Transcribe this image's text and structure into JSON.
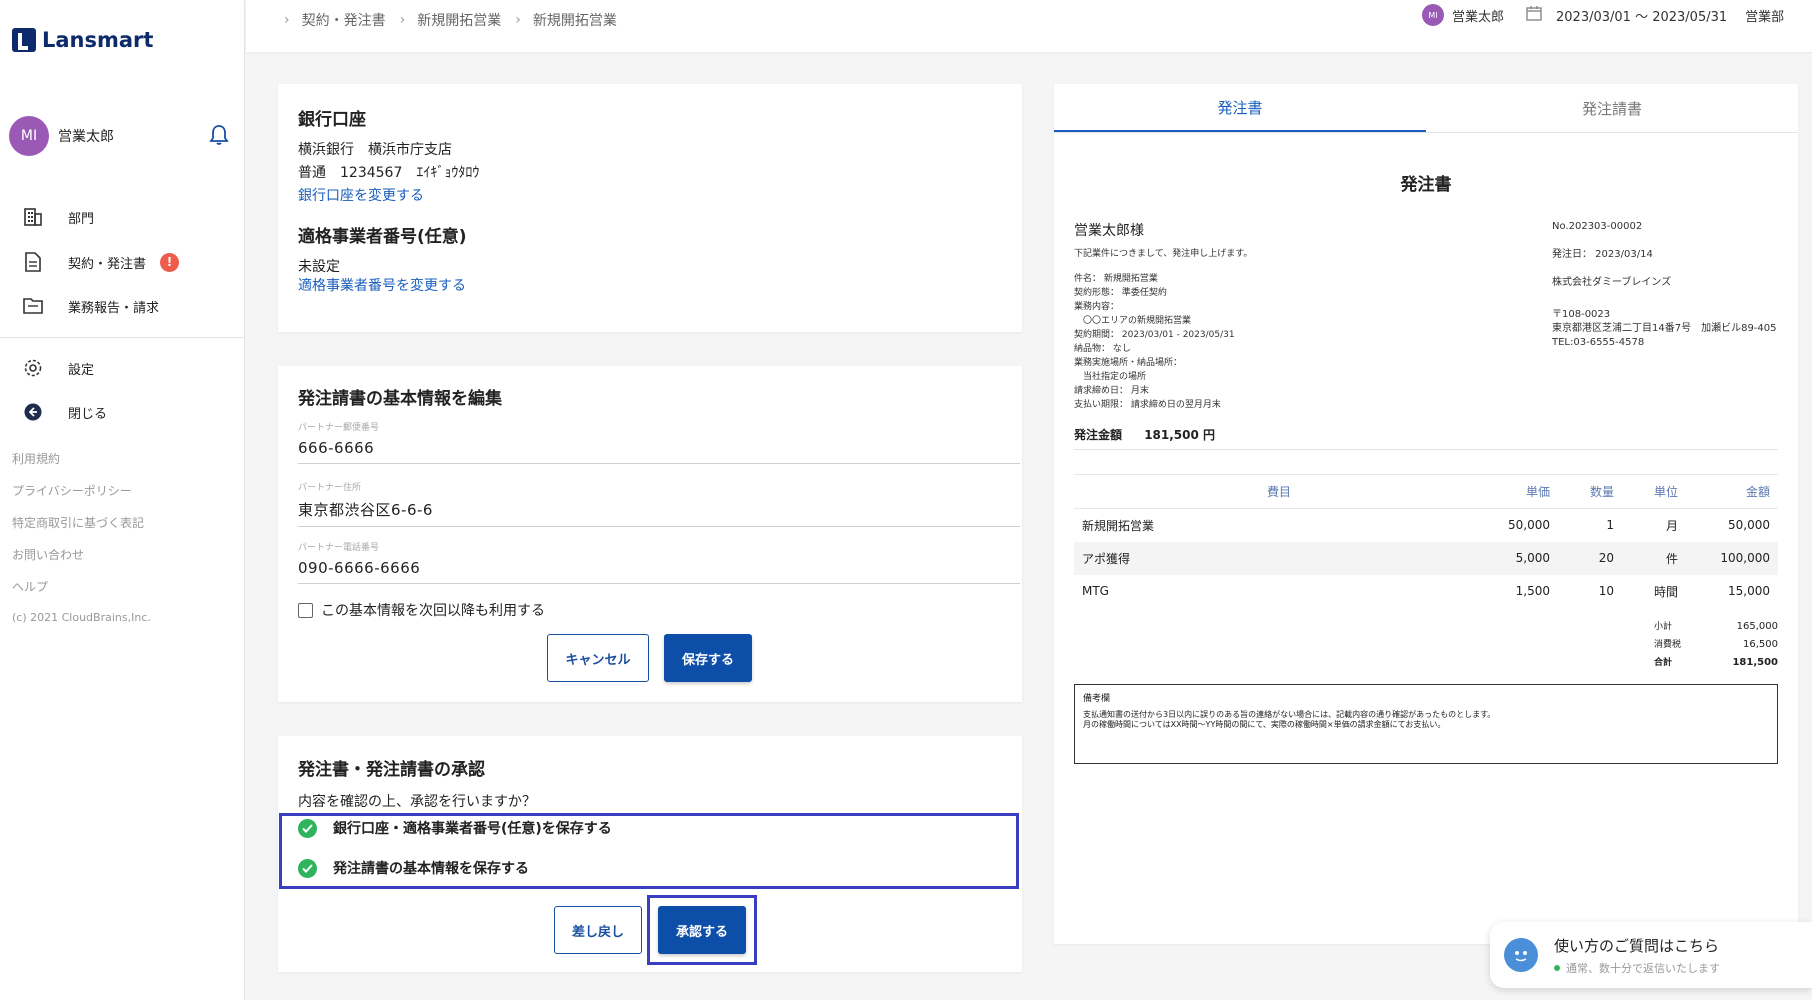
{
  "brand": {
    "name": "Lansmart"
  },
  "user": {
    "initials": "MI",
    "name": "営業太郎"
  },
  "sidebar": {
    "nav": [
      {
        "label": "部門"
      },
      {
        "label": "契約・発注書",
        "badge": "!"
      },
      {
        "label": "業務報告・請求"
      }
    ],
    "settings": "設定",
    "close": "閉じる",
    "footer_links": [
      "利用規約",
      "プライバシーポリシー",
      "特定商取引に基づく表記",
      "お問い合わせ",
      "ヘルプ"
    ],
    "copyright": "(c) 2021 CloudBrains,Inc."
  },
  "topbar": {
    "breadcrumb": [
      "契約・発注書",
      "新規開拓営業",
      "新規開拓営業"
    ],
    "user_initials": "MI",
    "user_name": "営業太郎",
    "period": "2023/03/01 ～ 2023/05/31",
    "department": "営業部"
  },
  "bank": {
    "title": "銀行口座",
    "line1": "横浜銀行　横浜市庁支店",
    "line2": "普通　1234567　ｴｲｷﾞｮｳﾀﾛｳ",
    "change_link": "銀行口座を変更する",
    "invoice_title": "適格事業者番号(任意)",
    "invoice_value": "未設定",
    "invoice_link": "適格事業者番号を変更する"
  },
  "basic_info": {
    "title": "発注請書の基本情報を編集",
    "postal_label": "パートナー郵便番号",
    "postal_value": "666-6666",
    "address_label": "パートナー住所",
    "address_value": "東京都渋谷区6-6-6",
    "phone_label": "パートナー電話番号",
    "phone_value": "090-6666-6666",
    "reuse_label": "この基本情報を次回以降も利用する",
    "cancel": "キャンセル",
    "save": "保存する"
  },
  "approval": {
    "title": "発注書・発注請書の承認",
    "question": "内容を確認の上、承認を行いますか？",
    "item1": "銀行口座・適格事業者番号(任意)を保存する",
    "item2": "発注請書の基本情報を保存する",
    "return": "差し戻し",
    "approve": "承認する"
  },
  "document": {
    "tabs": [
      "発注書",
      "発注請書"
    ],
    "title": "発注書",
    "recipient": "営業太郎様",
    "intro": "下記業件につきまして、発注申し上げます。",
    "details": [
      "件名：  新規開拓営業",
      "契約形態：  準委任契約",
      "業務内容：",
      "　〇〇エリアの新規開拓営業",
      "契約期間：  2023/03/01 - 2023/05/31",
      "納品物：  なし",
      "業務実施場所・納品場所：",
      "　当社指定の場所",
      "請求締め日：  月末",
      "支払い期限：  請求締め日の翌月月末"
    ],
    "amount_label": "発注金額",
    "amount_value": "181,500 円",
    "doc_no": "No.202303-00002",
    "order_date": "発注日：  2023/03/14",
    "company": "株式会社ダミーブレインズ",
    "zip": "〒108-0023",
    "address": "東京都港区芝浦二丁目14番7号　加瀬ビル89-405",
    "tel": "TEL:03-6555-4578",
    "table_headers": [
      "費目",
      "単価",
      "数量",
      "単位",
      "金額"
    ],
    "rows": [
      [
        "新規開拓営業",
        "50,000",
        "1",
        "月",
        "50,000"
      ],
      [
        "アポ獲得",
        "5,000",
        "20",
        "件",
        "100,000"
      ],
      [
        "MTG",
        "1,500",
        "10",
        "時間",
        "15,000"
      ]
    ],
    "subtotal_label": "小計",
    "subtotal": "165,000",
    "tax_label": "消費税",
    "tax": "16,500",
    "total_label": "合計",
    "total": "181,500",
    "remarks_title": "備考欄",
    "remarks_line1": "支払通知書の送付から3日以内に誤りのある旨の連絡がない場合には、記載内容の通り確認があったものとします。",
    "remarks_line2": "月の稼働時間についてはXX時間〜YY時間の間にて、実際の稼働時間×単価の請求金額にてお支払い。"
  },
  "chat": {
    "title": "使い方のご質問はこちら",
    "status": "通常、数十分で返信いたします"
  },
  "colors": {
    "primary": "#0d4fa8",
    "highlight": "#3a3ec0",
    "link": "#1a5fbf",
    "success": "#2fb35c",
    "badge": "#ef5b4c"
  }
}
